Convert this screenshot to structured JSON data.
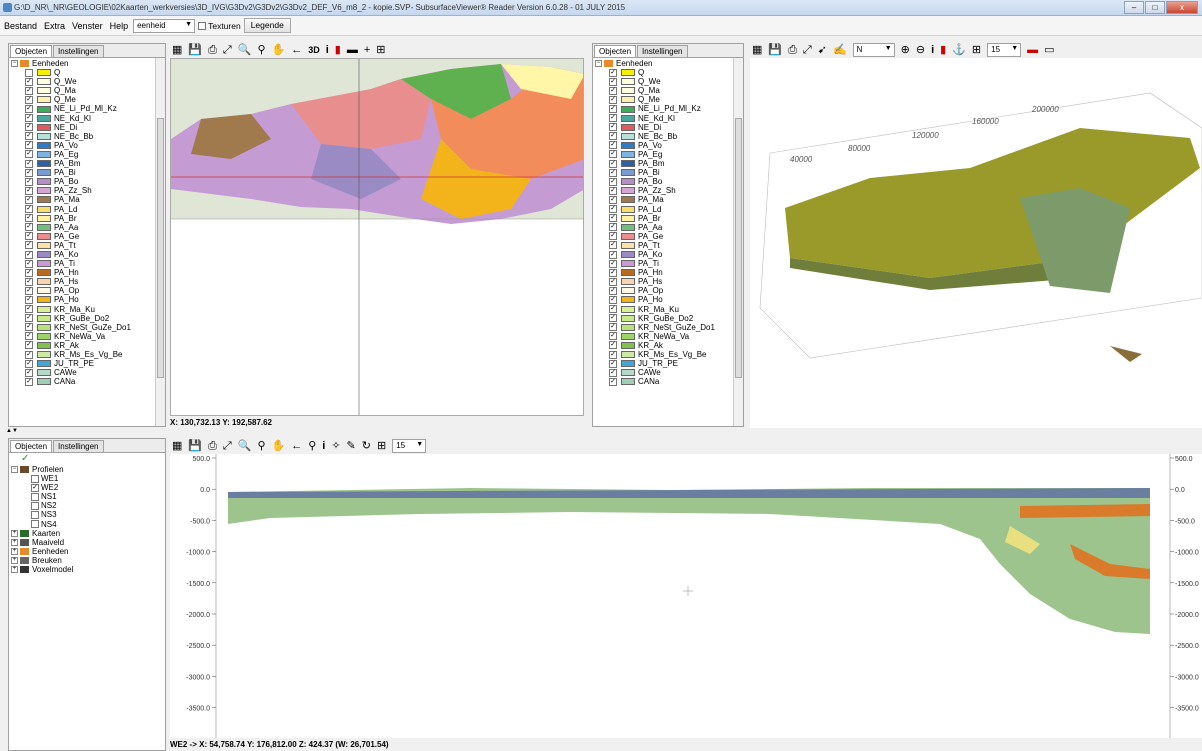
{
  "window": {
    "title": "G:\\D_NR\\_NR\\GEOLOGIE\\02Kaarten_werkversies\\3D_IVG\\G3Dv2\\G3Dv2\\G3Dv2_DEF_V6_m8_2 - kopie.SVP- SubsurfaceViewer® Reader Version 6.0.28 - 01 JULY 2015",
    "minimize": "–",
    "maximize": "□",
    "close": "x"
  },
  "menu": {
    "items": [
      "Bestand",
      "Extra",
      "Venster",
      "Help"
    ],
    "combo_value": "eenheid",
    "textures_label": "Texturen",
    "legend_button": "Legende"
  },
  "tabs": {
    "objects": "Objecten",
    "settings": "Instellingen"
  },
  "units_root": "Eenheden",
  "left_units": [
    {
      "name": "Q",
      "color": "#f7f000",
      "checked": false
    },
    {
      "name": "Q_We",
      "color": "#fffde0",
      "checked": true
    },
    {
      "name": "Q_Ma",
      "color": "#fffde0",
      "checked": true
    },
    {
      "name": "Q_Me",
      "color": "#fff2b0",
      "checked": true
    },
    {
      "name": "NE_Li_Pd_Ml_Kz",
      "color": "#3cae5a",
      "checked": true
    },
    {
      "name": "NE_Kd_Kl",
      "color": "#4aa89e",
      "checked": true
    },
    {
      "name": "NE_Di",
      "color": "#e25b5b",
      "checked": true
    },
    {
      "name": "NE_Bc_Bb",
      "color": "#b9e0d8",
      "checked": true
    },
    {
      "name": "PA_Vo",
      "color": "#2b7cc9",
      "checked": true
    },
    {
      "name": "PA_Eg",
      "color": "#7fb4e0",
      "checked": true
    },
    {
      "name": "PA_Bm",
      "color": "#2d5ea7",
      "checked": true
    },
    {
      "name": "PA_Bi",
      "color": "#7b9bd0",
      "checked": true
    },
    {
      "name": "PA_Bo",
      "color": "#b88bc9",
      "checked": true
    },
    {
      "name": "PA_Zz_Sh",
      "color": "#d7a6d3",
      "checked": true
    },
    {
      "name": "PA_Ma",
      "color": "#a07a4d",
      "checked": true
    },
    {
      "name": "PA_Ld",
      "color": "#f7df6a",
      "checked": true
    },
    {
      "name": "PA_Br",
      "color": "#fff2a0",
      "checked": true
    },
    {
      "name": "PA_Aa",
      "color": "#72c07a",
      "checked": true
    },
    {
      "name": "PA_Ge",
      "color": "#e88e8e",
      "checked": true
    },
    {
      "name": "PA_Tt",
      "color": "#fbe0a8",
      "checked": true
    },
    {
      "name": "PA_Ko",
      "color": "#9b8bc4",
      "checked": true
    },
    {
      "name": "PA_Ti",
      "color": "#c79bd6",
      "checked": true
    },
    {
      "name": "PA_Hn",
      "color": "#b86a1e",
      "checked": true
    },
    {
      "name": "PA_Hs",
      "color": "#f5d6b0",
      "checked": true
    },
    {
      "name": "PA_Op",
      "color": "#fff8e6",
      "checked": true
    },
    {
      "name": "PA_Ho",
      "color": "#f3b31b",
      "checked": true
    },
    {
      "name": "KR_Ma_Ku",
      "color": "#d7f09a",
      "checked": true
    },
    {
      "name": "KR_GuBe_Do2",
      "color": "#c9ea8a",
      "checked": true
    },
    {
      "name": "KR_NeSt_GuZe_Do1",
      "color": "#b9e27a",
      "checked": true
    },
    {
      "name": "KR_NeWa_Va",
      "color": "#9fd46a",
      "checked": true
    },
    {
      "name": "KR_Ak",
      "color": "#7fc24e",
      "checked": true
    },
    {
      "name": "KR_Ms_Es_Vg_Be",
      "color": "#cfe9a6",
      "checked": true
    },
    {
      "name": "JU_TR_PE",
      "color": "#44a6d6",
      "checked": true
    },
    {
      "name": "CAWe",
      "color": "#b5d9c9",
      "checked": true
    },
    {
      "name": "CANa",
      "color": "#9fcdb5",
      "checked": true
    }
  ],
  "right_units": [
    {
      "name": "Q",
      "color": "#f7f000"
    },
    {
      "name": "Q_We",
      "color": "#fffde0"
    },
    {
      "name": "Q_Ma",
      "color": "#fffde0"
    },
    {
      "name": "Q_Me",
      "color": "#fff2b0"
    },
    {
      "name": "NE_Li_Pd_Ml_Kz",
      "color": "#3cae5a"
    },
    {
      "name": "NE_Kd_Kl",
      "color": "#4aa89e"
    },
    {
      "name": "NE_Di",
      "color": "#e25b5b"
    },
    {
      "name": "NE_Bc_Bb",
      "color": "#b9e0d8"
    },
    {
      "name": "PA_Vo",
      "color": "#2b7cc9"
    },
    {
      "name": "PA_Eg",
      "color": "#7fb4e0"
    },
    {
      "name": "PA_Bm",
      "color": "#2d5ea7"
    },
    {
      "name": "PA_Bi",
      "color": "#7b9bd0"
    },
    {
      "name": "PA_Bo",
      "color": "#b88bc9"
    },
    {
      "name": "PA_Zz_Sh",
      "color": "#d7a6d3"
    },
    {
      "name": "PA_Ma",
      "color": "#a07a4d"
    },
    {
      "name": "PA_Ld",
      "color": "#f7df6a"
    },
    {
      "name": "PA_Br",
      "color": "#fff2a0"
    },
    {
      "name": "PA_Aa",
      "color": "#72c07a"
    },
    {
      "name": "PA_Ge",
      "color": "#e88e8e"
    },
    {
      "name": "PA_Tt",
      "color": "#fbe0a8"
    },
    {
      "name": "PA_Ko",
      "color": "#9b8bc4"
    },
    {
      "name": "PA_Ti",
      "color": "#c79bd6"
    },
    {
      "name": "PA_Hn",
      "color": "#b86a1e"
    },
    {
      "name": "PA_Hs",
      "color": "#f5d6b0"
    },
    {
      "name": "PA_Op",
      "color": "#fff8e6"
    },
    {
      "name": "PA_Ho",
      "color": "#f3b31b"
    },
    {
      "name": "KR_Ma_Ku",
      "color": "#d7f09a"
    },
    {
      "name": "KR_GuBe_Do2",
      "color": "#c9ea8a"
    },
    {
      "name": "KR_NeSt_GuZe_Do1",
      "color": "#b9e27a"
    },
    {
      "name": "KR_NeWa_Va",
      "color": "#9fd46a"
    },
    {
      "name": "KR_Ak",
      "color": "#7fc24e"
    },
    {
      "name": "KR_Ms_Es_Vg_Be",
      "color": "#cfe9a6"
    },
    {
      "name": "JU_TR_PE",
      "color": "#44a6d6"
    },
    {
      "name": "CAWe",
      "color": "#b5d9c9"
    },
    {
      "name": "CANa",
      "color": "#9fcdb5"
    }
  ],
  "map_status": "X: 130,732.13 Y: 192,587.62",
  "view3d": {
    "north_value": "N",
    "scale_value": "15",
    "axis_labels": [
      "40000",
      "80000",
      "120000",
      "160000",
      "200000"
    ]
  },
  "profile_panel": {
    "tree": {
      "profiles": "Profielen",
      "items": [
        {
          "name": "WE1",
          "checked": false
        },
        {
          "name": "WE2",
          "checked": true
        },
        {
          "name": "NS1",
          "checked": false
        },
        {
          "name": "NS2",
          "checked": false
        },
        {
          "name": "NS3",
          "checked": false
        },
        {
          "name": "NS4",
          "checked": false
        }
      ],
      "others": [
        "Kaarten",
        "Maaiveld",
        "Eenheden",
        "Breuken",
        "Voxelmodel"
      ]
    },
    "scale_value": "15",
    "y_labels_left": [
      "500.0",
      "0.0",
      "-500.0",
      "-1000.0",
      "-1500.0",
      "-2000.0",
      "-2500.0",
      "-3000.0",
      "-3500.0"
    ],
    "y_labels_right": [
      "500.0",
      "0.0",
      "-500.0",
      "-1000.0",
      "-1500.0",
      "-2000.0",
      "-2500.0",
      "-3000.0",
      "-3500.0"
    ],
    "status": "WE2  -> X: 54,758.74 Y: 176,812.00 Z: 424.37 (W: 26,701.54)"
  }
}
